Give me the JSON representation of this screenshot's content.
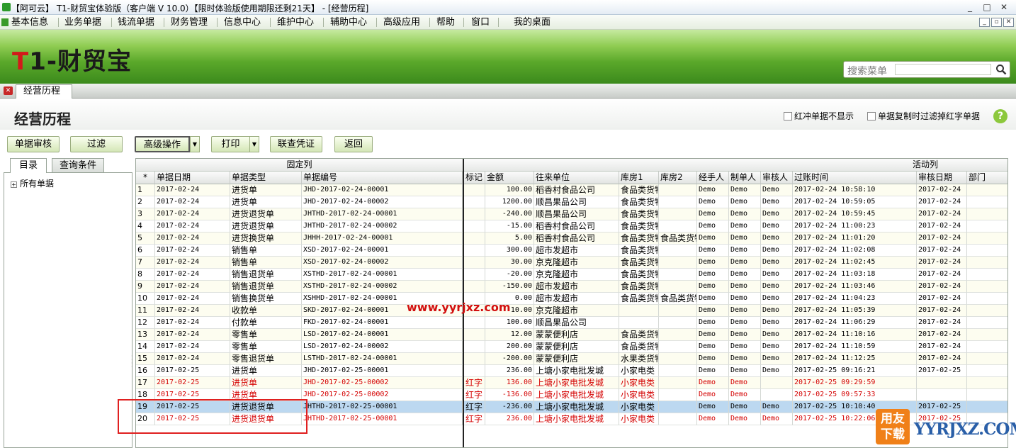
{
  "window": {
    "title": "【阿可云】 T1-财贸宝体验版（客户端 V 10.0）【限时体验版使用期限还剩21天】 - [经营历程]",
    "controls": [
      "_",
      "□",
      "✕"
    ]
  },
  "menu": {
    "items": [
      "基本信息",
      "业务单据",
      "钱流单据",
      "财务管理",
      "信息中心",
      "维护中心",
      "辅助中心",
      "高级应用",
      "帮助",
      "窗口",
      "我的桌面"
    ],
    "mdi_controls": [
      "_",
      "▫",
      "✕"
    ]
  },
  "banner": {
    "logo_red": "T",
    "logo_rest": "1-财贸宝",
    "search_label": "搜索菜单"
  },
  "doc_tab": {
    "label": "经营历程",
    "close_glyph": "✕"
  },
  "page": {
    "title": "经营历程",
    "options": [
      "红冲单据不显示",
      "单据复制时过滤掉红字单据"
    ],
    "help_glyph": "?"
  },
  "toolbar": {
    "audit": "单据审核",
    "filter": "过滤",
    "advanced": "高级操作",
    "print": "打印",
    "voucher": "联查凭证",
    "back": "返回",
    "dropdown_glyph": "▼"
  },
  "left": {
    "tabs": [
      "目录",
      "查询条件"
    ],
    "tree_expand": "+",
    "tree_root": "所有单据"
  },
  "grid": {
    "group_fixed": "固定列",
    "group_active": "活动列",
    "columns": [
      "*",
      "单据日期",
      "单据类型",
      "单据编号",
      "标记",
      "金额",
      "往来单位",
      "库房1",
      "库房2",
      "经手人",
      "制单人",
      "审核人",
      "过账时间",
      "审核日期",
      "部门"
    ],
    "rows": [
      [
        "1",
        "2017-02-24",
        "进货单",
        "JHD-2017-02-24-00001",
        "",
        "100.00",
        "稻香村食品公司",
        "食品类货物",
        "",
        "Demo",
        "Demo",
        "Demo",
        "2017-02-24 10:58:10",
        "2017-02-24",
        ""
      ],
      [
        "2",
        "2017-02-24",
        "进货单",
        "JHD-2017-02-24-00002",
        "",
        "1200.00",
        "顺昌果品公司",
        "食品类货物",
        "",
        "Demo",
        "Demo",
        "Demo",
        "2017-02-24 10:59:05",
        "2017-02-24",
        ""
      ],
      [
        "3",
        "2017-02-24",
        "进货退货单",
        "JHTHD-2017-02-24-00001",
        "",
        "-240.00",
        "顺昌果品公司",
        "食品类货物",
        "",
        "Demo",
        "Demo",
        "Demo",
        "2017-02-24 10:59:45",
        "2017-02-24",
        ""
      ],
      [
        "4",
        "2017-02-24",
        "进货退货单",
        "JHTHD-2017-02-24-00002",
        "",
        "-15.00",
        "稻香村食品公司",
        "食品类货物",
        "",
        "Demo",
        "Demo",
        "Demo",
        "2017-02-24 11:00:23",
        "2017-02-24",
        ""
      ],
      [
        "5",
        "2017-02-24",
        "进货换货单",
        "JHHH-2017-02-24-00001",
        "",
        "5.00",
        "稻香村食品公司",
        "食品类货物",
        "食品类货物",
        "Demo",
        "Demo",
        "Demo",
        "2017-02-24 11:01:20",
        "2017-02-24",
        ""
      ],
      [
        "6",
        "2017-02-24",
        "销售单",
        "XSD-2017-02-24-00001",
        "",
        "300.00",
        "超市发超市",
        "食品类货物",
        "",
        "Demo",
        "Demo",
        "Demo",
        "2017-02-24 11:02:08",
        "2017-02-24",
        ""
      ],
      [
        "7",
        "2017-02-24",
        "销售单",
        "XSD-2017-02-24-00002",
        "",
        "30.00",
        "京克隆超市",
        "食品类货物",
        "",
        "Demo",
        "Demo",
        "Demo",
        "2017-02-24 11:02:45",
        "2017-02-24",
        ""
      ],
      [
        "8",
        "2017-02-24",
        "销售退货单",
        "XSTHD-2017-02-24-00001",
        "",
        "-20.00",
        "京克隆超市",
        "食品类货物",
        "",
        "Demo",
        "Demo",
        "Demo",
        "2017-02-24 11:03:18",
        "2017-02-24",
        ""
      ],
      [
        "9",
        "2017-02-24",
        "销售退货单",
        "XSTHD-2017-02-24-00002",
        "",
        "-150.00",
        "超市发超市",
        "食品类货物",
        "",
        "Demo",
        "Demo",
        "Demo",
        "2017-02-24 11:03:46",
        "2017-02-24",
        ""
      ],
      [
        "10",
        "2017-02-24",
        "销售换货单",
        "XSHHD-2017-02-24-00001",
        "",
        "0.00",
        "超市发超市",
        "食品类货物",
        "食品类货物",
        "Demo",
        "Demo",
        "Demo",
        "2017-02-24 11:04:23",
        "2017-02-24",
        ""
      ],
      [
        "11",
        "2017-02-24",
        "收款单",
        "SKD-2017-02-24-00001",
        "",
        "10.00",
        "京克隆超市",
        "",
        "",
        "Demo",
        "Demo",
        "Demo",
        "2017-02-24 11:05:39",
        "2017-02-24",
        ""
      ],
      [
        "12",
        "2017-02-24",
        "付款单",
        "FKD-2017-02-24-00001",
        "",
        "100.00",
        "顺昌果品公司",
        "",
        "",
        "Demo",
        "Demo",
        "Demo",
        "2017-02-24 11:06:29",
        "2017-02-24",
        ""
      ],
      [
        "13",
        "2017-02-24",
        "零售单",
        "LSD-2017-02-24-00001",
        "",
        "12.00",
        "蒙蒙便利店",
        "食品类货物",
        "",
        "Demo",
        "Demo",
        "Demo",
        "2017-02-24 11:10:16",
        "2017-02-24",
        ""
      ],
      [
        "14",
        "2017-02-24",
        "零售单",
        "LSD-2017-02-24-00002",
        "",
        "200.00",
        "蒙蒙便利店",
        "食品类货物",
        "",
        "Demo",
        "Demo",
        "Demo",
        "2017-02-24 11:10:59",
        "2017-02-24",
        ""
      ],
      [
        "15",
        "2017-02-24",
        "零售退货单",
        "LSTHD-2017-02-24-00001",
        "",
        "-200.00",
        "蒙蒙便利店",
        "水果类货物",
        "",
        "Demo",
        "Demo",
        "Demo",
        "2017-02-24 11:12:25",
        "2017-02-24",
        ""
      ],
      [
        "16",
        "2017-02-25",
        "进货单",
        "JHD-2017-02-25-00001",
        "",
        "236.00",
        "上塘小家电批发城",
        "小家电类",
        "",
        "Demo",
        "Demo",
        "Demo",
        "2017-02-25 09:16:21",
        "2017-02-25",
        ""
      ],
      [
        "17",
        "2017-02-25",
        "进货单",
        "JHD-2017-02-25-00002",
        "红字",
        "136.00",
        "上塘小家电批发城",
        "小家电类",
        "",
        "Demo",
        "Demo",
        "",
        "2017-02-25 09:29:59",
        "",
        ""
      ],
      [
        "18",
        "2017-02-25",
        "进货单",
        "JHD-2017-02-25-00002",
        "红字",
        "-136.00",
        "上塘小家电批发城",
        "小家电类",
        "",
        "Demo",
        "Demo",
        "",
        "2017-02-25 09:57:33",
        "",
        ""
      ],
      [
        "19",
        "2017-02-25",
        "进货退货单",
        "JHTHD-2017-02-25-00001",
        "红字",
        "-236.00",
        "上塘小家电批发城",
        "小家电类",
        "",
        "Demo",
        "Demo",
        "Demo",
        "2017-02-25 10:10:40",
        "2017-02-25",
        ""
      ],
      [
        "20",
        "2017-02-25",
        "进货退货单",
        "JHTHD-2017-02-25-00001",
        "红字",
        "236.00",
        "上塘小家电批发城",
        "小家电类",
        "",
        "Demo",
        "Demo",
        "Demo",
        "2017-02-25 10:22:06",
        "2017-02-25",
        ""
      ]
    ],
    "red_rows": [
      17,
      18,
      20
    ],
    "selected_row": 19
  },
  "overlay": {
    "watermark": "www.yyrjxz.com",
    "corner_logo_text": "用友下载",
    "corner_logo_site": "YYRJXZ.COM"
  }
}
